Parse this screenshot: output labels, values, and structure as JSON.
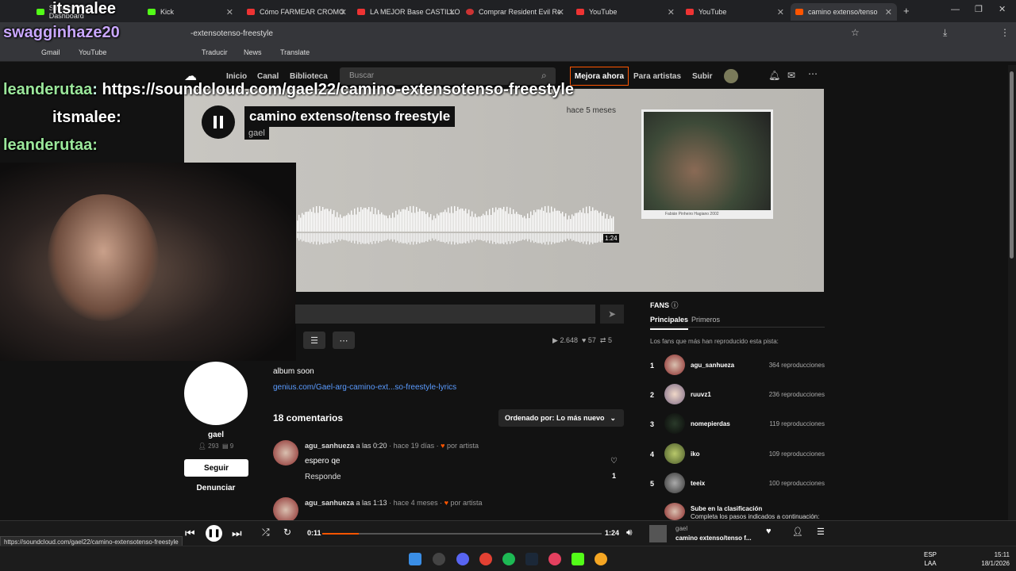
{
  "browser": {
    "tabs": [
      {
        "label": "Stream - Kick Dashboard"
      },
      {
        "label": "Kick"
      },
      {
        "label": "Cómo FARMEAR CROMO"
      },
      {
        "label": "LA MEJOR Base CASTILLO"
      },
      {
        "label": "Comprar Resident Evil Re"
      },
      {
        "label": "YouTube"
      },
      {
        "label": "YouTube"
      },
      {
        "label": "camino extenso/tenso"
      }
    ],
    "url": "-extensotenso-freestyle",
    "bookmarks": [
      "Gmail",
      "YouTube",
      "Traducir",
      "News",
      "Translate"
    ]
  },
  "chat": [
    {
      "user": "swagginhaze20",
      "msg": ""
    },
    {
      "user": "itsmalee",
      "msg": ""
    },
    {
      "user": "leanderutaa",
      "msg": "https://soundcloud.com/gael22/camino-extensotenso-freestyle"
    },
    {
      "user": "itsmalee",
      "msg": ""
    },
    {
      "user": "leanderutaa",
      "msg": ""
    }
  ],
  "header": {
    "nav": [
      "Inicio",
      "Canal",
      "Biblioteca"
    ],
    "search_placeholder": "Buscar",
    "upgrade": "Mejora ahora",
    "artists": "Para artistas",
    "upload": "Subir"
  },
  "track": {
    "title": "camino extenso/tenso freestyle",
    "artist": "gael",
    "ago": "hace 5 meses",
    "duration_marker": "1:24",
    "art_caption": "Fabián Pinheiro Hagiano 2002"
  },
  "stats": {
    "plays": "2.648",
    "likes": "57",
    "reposts": "5"
  },
  "profile": {
    "name": "gael",
    "followers": "293",
    "tracks": "9",
    "follow": "Seguir",
    "report": "Denunciar"
  },
  "description": {
    "text": "album soon",
    "link": "genius.com/Gael-arg-camino-ext...so-freestyle-lyrics"
  },
  "comments": {
    "count_label": "18 comentarios",
    "sort_label": "Ordenado por: Lo más nuevo",
    "items": [
      {
        "user": "agu_sanhueza",
        "at": " a las ",
        "time": "0:20",
        "ago": " · hace 19 días ·",
        "by_artist": "por artista",
        "text": "espero qe",
        "reply": "Responde",
        "likes": "1"
      },
      {
        "user": "agu_sanhueza",
        "at": " a las ",
        "time": "1:13",
        "ago": " · hace 4 meses ·",
        "by_artist": "por artista",
        "text": "",
        "reply": "",
        "likes": ""
      }
    ]
  },
  "fans": {
    "title": "FANS",
    "tabs": [
      "Principales",
      "Primeros"
    ],
    "subtitle": "Los fans que más han reproducido esta pista:",
    "list": [
      {
        "rank": "1",
        "name": "agu_sanhueza",
        "plays": "364 reproducciones"
      },
      {
        "rank": "2",
        "name": "ruuvz1",
        "plays": "236 reproducciones"
      },
      {
        "rank": "3",
        "name": "nomepierdas",
        "plays": "119 reproducciones"
      },
      {
        "rank": "4",
        "name": "iko",
        "plays": "109 reproducciones"
      },
      {
        "rank": "5",
        "name": "teeix",
        "plays": "100 reproducciones"
      }
    ],
    "climb_title": "Sube en la clasificación",
    "climb_sub": "Completa los pasos indicados a continuación:"
  },
  "player": {
    "current": "0:11",
    "duration": "1:24",
    "progress": 0.13,
    "artist": "gael",
    "title": "camino extenso/tenso f..."
  },
  "status_url": "https://soundcloud.com/gael22/camino-extensotenso-freestyle",
  "taskbar": {
    "lang1": "ESP",
    "lang2": "LAA",
    "time": "15:11",
    "date": "18/1/2026"
  },
  "colors": {
    "accent": "#ff5500",
    "link": "#5a9bff"
  }
}
